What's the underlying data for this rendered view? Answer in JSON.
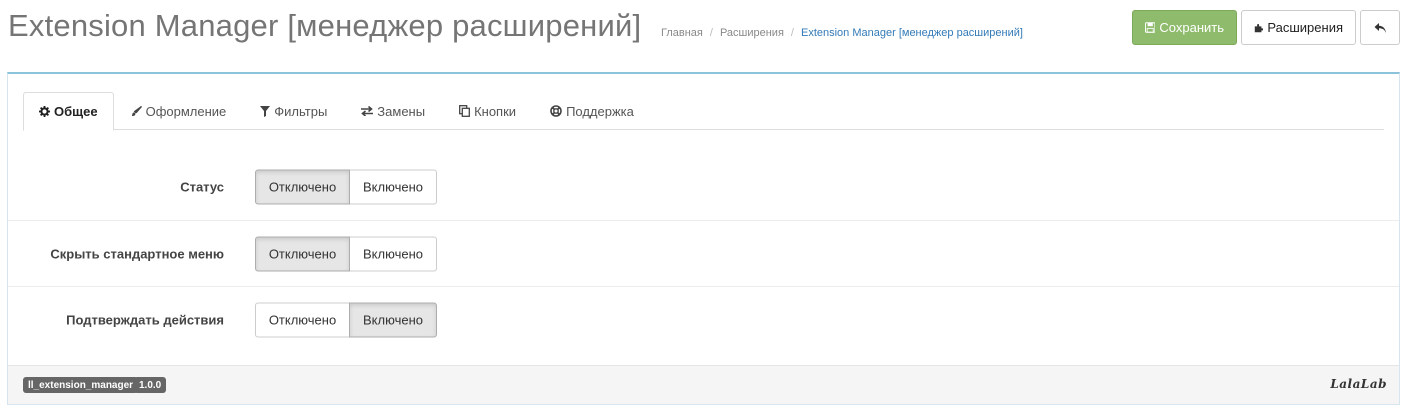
{
  "header": {
    "title": "Extension Manager [менеджер расширений]",
    "breadcrumb": [
      "Главная",
      "Расширения",
      "Extension Manager [менеджер расширений]"
    ],
    "separator": "/"
  },
  "toolbar": {
    "save_label": "Сохранить",
    "extensions_label": "Расширения",
    "save_icon": "floppy-icon",
    "extensions_icon": "puzzle-icon",
    "back_icon": "reply-icon",
    "save_color": "#8fbb6c"
  },
  "tabs": [
    {
      "label": "Общее",
      "icon": "gear-icon",
      "active": true
    },
    {
      "label": "Оформление",
      "icon": "brush-icon",
      "active": false
    },
    {
      "label": "Фильтры",
      "icon": "filter-icon",
      "active": false
    },
    {
      "label": "Замены",
      "icon": "exchange-icon",
      "active": false
    },
    {
      "label": "Кнопки",
      "icon": "copy-icon",
      "active": false
    },
    {
      "label": "Поддержка",
      "icon": "lifebuoy-icon",
      "active": false
    }
  ],
  "settings": [
    {
      "label": "Статус",
      "off_label": "Отключено",
      "on_label": "Включено",
      "value": "Отключено"
    },
    {
      "label": "Скрыть стандартное меню",
      "off_label": "Отключено",
      "on_label": "Включено",
      "value": "Отключено"
    },
    {
      "label": "Подтверждать действия",
      "off_label": "Отключено",
      "on_label": "Включено",
      "value": "Включено"
    }
  ],
  "footer": {
    "module_name": "ll_extension_manager",
    "version": "1.0.0",
    "logo_text": "LalaLab"
  }
}
